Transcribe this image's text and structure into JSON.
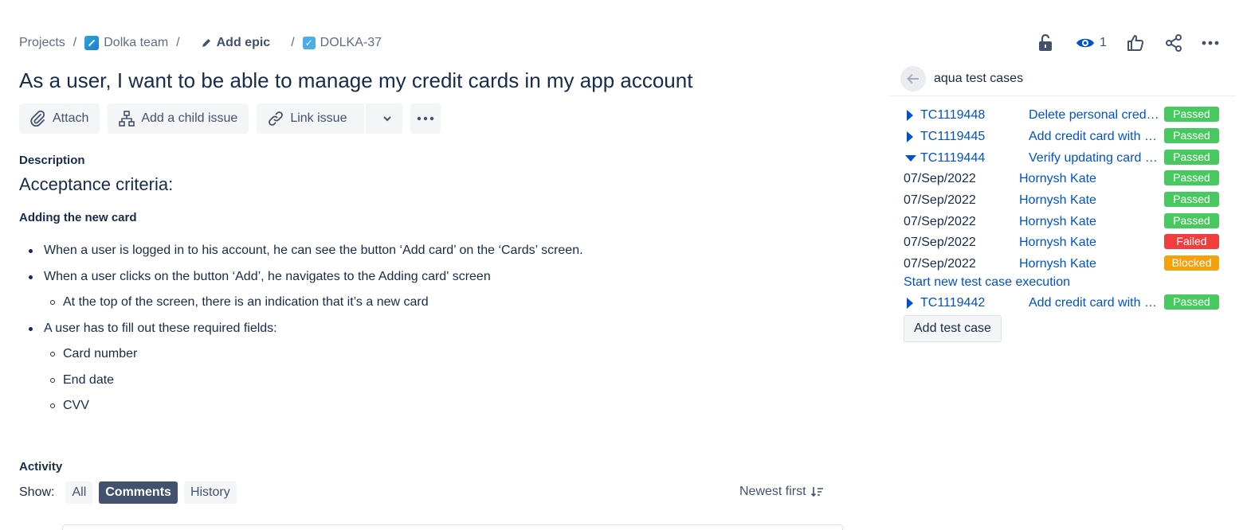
{
  "breadcrumb": {
    "projects": "Projects",
    "team": "Dolka team",
    "epic": "Add epic",
    "issue_key": "DOLKA-37",
    "separator": "/"
  },
  "top_actions": {
    "watch_count": "1"
  },
  "title": "As a user, I want to be able to manage my credit cards in my app account",
  "toolbar": {
    "attach": "Attach",
    "add_child": "Add a child issue",
    "link_issue": "Link issue"
  },
  "description": {
    "label": "Description",
    "heading": "Acceptance criteria:",
    "subheading": "Adding the new card",
    "items": [
      "When a user is logged in to his account, he can see the button ‘Add card’ on the ‘Cards’ screen.",
      "When a user clicks on the button ‘Add’, he navigates to the Adding card' screen",
      "At the top of the screen, there is an indication that it’s a new card",
      "A user has to fill out these required fields:",
      "Card number",
      "End date",
      "CVV"
    ]
  },
  "activity": {
    "label": "Activity",
    "show_label": "Show:",
    "filters": [
      "All",
      "Comments",
      "History"
    ],
    "active_filter": "Comments",
    "sort_label": "Newest first"
  },
  "panel": {
    "title": "aqua test cases",
    "test_cases": [
      {
        "id": "TC1119448",
        "name": "Delete personal cred…",
        "status": "Passed"
      },
      {
        "id": "TC1119445",
        "name": "Add credit card with …",
        "status": "Passed"
      },
      {
        "id": "TC1119444",
        "name": "Verify updating card …",
        "status": "Passed"
      },
      {
        "id": "TC1119442",
        "name": "Add credit card with …",
        "status": "Passed"
      }
    ],
    "executions": [
      {
        "date": "07/Sep/2022",
        "user": "Hornysh Kate",
        "status": "Passed"
      },
      {
        "date": "07/Sep/2022",
        "user": "Hornysh Kate",
        "status": "Passed"
      },
      {
        "date": "07/Sep/2022",
        "user": "Hornysh Kate",
        "status": "Passed"
      },
      {
        "date": "07/Sep/2022",
        "user": "Hornysh Kate",
        "status": "Failed"
      },
      {
        "date": "07/Sep/2022",
        "user": "Hornysh Kate",
        "status": "Blocked"
      }
    ],
    "start_link": "Start new test case execution",
    "add_button": "Add test case"
  },
  "colors": {
    "passed": "#48c95f",
    "failed": "#f23d3d",
    "blocked": "#f5a10d",
    "link": "#0052cc"
  }
}
